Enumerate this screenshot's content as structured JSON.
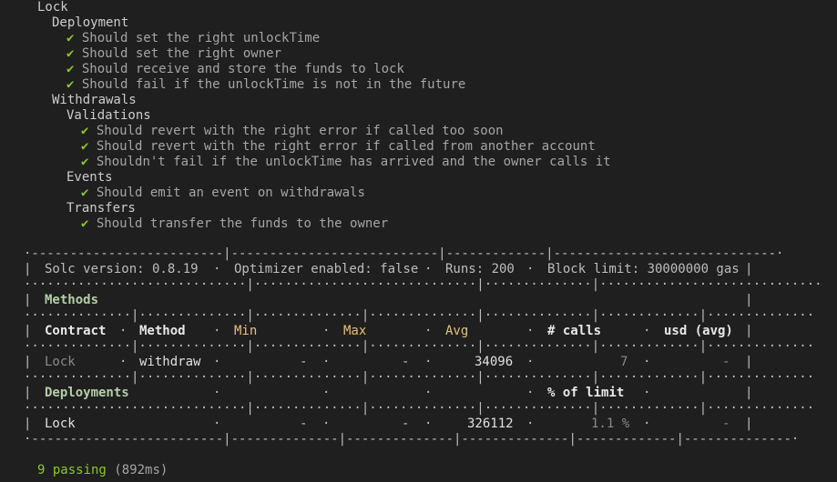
{
  "suite": {
    "name": "Lock",
    "deployment": {
      "title": "Deployment",
      "tests": [
        "Should set the right unlockTime",
        "Should set the right owner",
        "Should receive and store the funds to lock",
        "Should fail if the unlockTime is not in the future"
      ]
    },
    "withdrawals": {
      "title": "Withdrawals",
      "validations": {
        "title": "Validations",
        "tests": [
          "Should revert with the right error if called too soon",
          "Should revert with the right error if called from another account",
          "Shouldn't fail if the unlockTime has arrived and the owner calls it"
        ]
      },
      "events": {
        "title": "Events",
        "tests": [
          "Should emit an event on withdrawals"
        ]
      },
      "transfers": {
        "title": "Transfers",
        "tests": [
          "Should transfer the funds to the owner"
        ]
      }
    },
    "check": "✔"
  },
  "gas": {
    "header": {
      "solc": "Solc version: 0.8.19",
      "optimizer": "Optimizer enabled: false",
      "runs": "Runs: 200",
      "block": "Block limit: 30000000 gas"
    },
    "methods_title": "Methods",
    "columns": {
      "contract": "Contract",
      "method": "Method",
      "min": "Min",
      "max": "Max",
      "avg": "Avg",
      "calls": "# calls",
      "usd": "usd (avg)"
    },
    "method_row": {
      "contract": "Lock",
      "method": "withdraw",
      "min": "-",
      "max": "-",
      "avg": "34096",
      "calls": "7",
      "usd": "-"
    },
    "deployments_title": "Deployments",
    "pct_limit": "% of limit",
    "deploy_row": {
      "contract": "Lock",
      "min": "-",
      "max": "-",
      "avg": "326112",
      "pct": "1.1 %",
      "usd": "-"
    }
  },
  "summary": {
    "passing": "9 passing",
    "duration": "(892ms)"
  }
}
